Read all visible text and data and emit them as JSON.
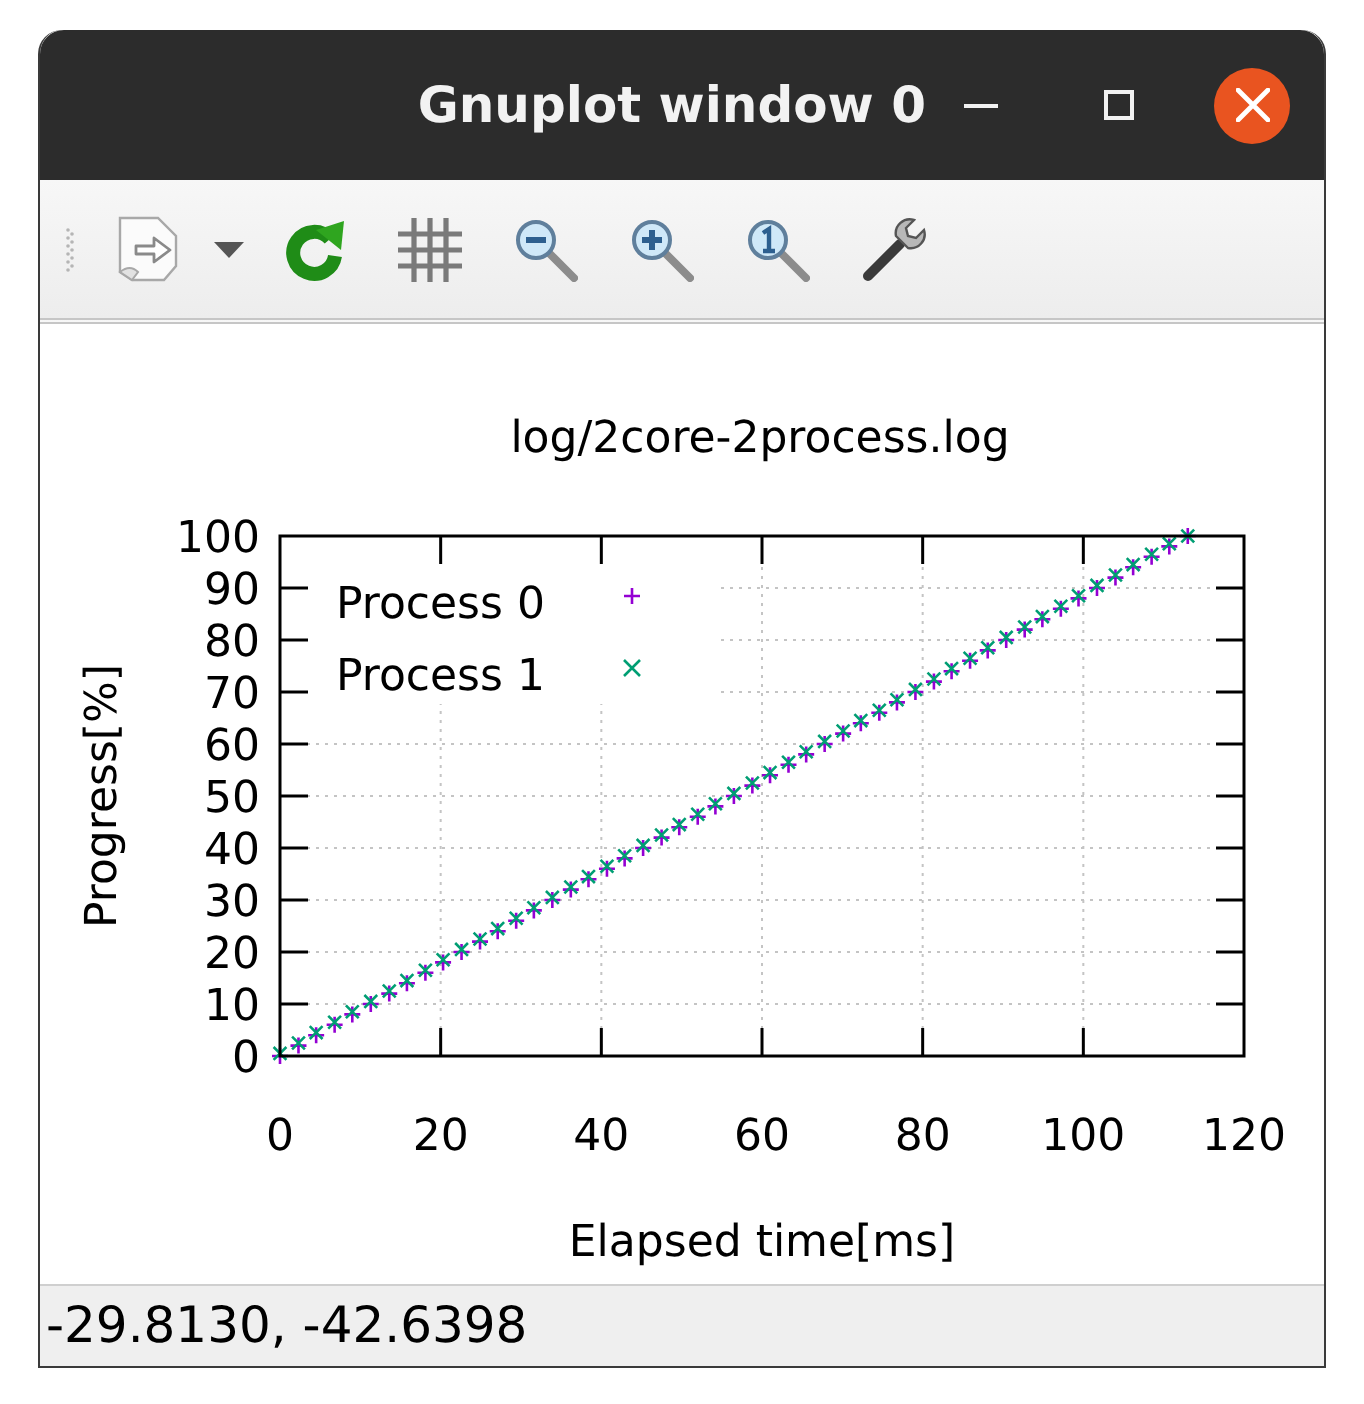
{
  "window": {
    "title": "Gnuplot window 0"
  },
  "plot": {
    "chart_data": {
      "type": "scatter",
      "title": "log/2core-2process.log",
      "xlabel": "Elapsed time[ms]",
      "ylabel": "Progress[%]",
      "x": [
        0,
        2.3,
        4.5,
        6.8,
        9,
        11.3,
        13.6,
        15.8,
        18.1,
        20.3,
        22.6,
        24.9,
        27.1,
        29.4,
        31.6,
        33.9,
        36.2,
        38.4,
        40.7,
        42.9,
        45.2,
        47.5,
        49.7,
        52,
        54.2,
        56.5,
        58.8,
        61,
        63.3,
        65.5,
        67.8,
        70.1,
        72.3,
        74.6,
        76.8,
        79.1,
        81.4,
        83.6,
        85.9,
        88.1,
        90.4,
        92.7,
        94.9,
        97.2,
        99.4,
        101.7,
        104,
        106.2,
        108.5,
        110.7,
        113
      ],
      "series": [
        {
          "name": "Process 0",
          "color": "#9400d3",
          "values": [
            0,
            2,
            4,
            6,
            8,
            10,
            12,
            14,
            16,
            18,
            20,
            22,
            24,
            26,
            28,
            30,
            32,
            34,
            36,
            38,
            40,
            42,
            44,
            46,
            48,
            50,
            52,
            54,
            56,
            58,
            60,
            62,
            64,
            66,
            68,
            70,
            72,
            74,
            76,
            78,
            80,
            82,
            84,
            86,
            88,
            90,
            92,
            94,
            96,
            98,
            100
          ]
        },
        {
          "name": "Process 1",
          "color": "#009e73",
          "values": [
            0.5,
            2.5,
            4.5,
            6.5,
            8.5,
            10.5,
            12.5,
            14.5,
            16.5,
            18.5,
            20.5,
            22.5,
            24.5,
            26.5,
            28.5,
            30.5,
            32.5,
            34.5,
            36.5,
            38.5,
            40.5,
            42.5,
            44.5,
            46.5,
            48.5,
            50.5,
            52.5,
            54.5,
            56.5,
            58.5,
            60.5,
            62.5,
            64.5,
            66.5,
            68.5,
            70.5,
            72.5,
            74.5,
            76.5,
            78.5,
            80.5,
            82.5,
            84.5,
            86.5,
            88.5,
            90.5,
            92.5,
            94.5,
            96.5,
            98.5,
            100
          ]
        }
      ],
      "xlim": [
        0,
        120
      ],
      "ylim": [
        0,
        100
      ],
      "xticks": [
        0,
        20,
        40,
        60,
        80,
        100,
        120
      ],
      "yticks": [
        0,
        10,
        20,
        30,
        40,
        50,
        60,
        70,
        80,
        90,
        100
      ],
      "grid": true,
      "legend": true
    }
  },
  "status_bar": {
    "text": "-29.8130, -42.6398"
  }
}
